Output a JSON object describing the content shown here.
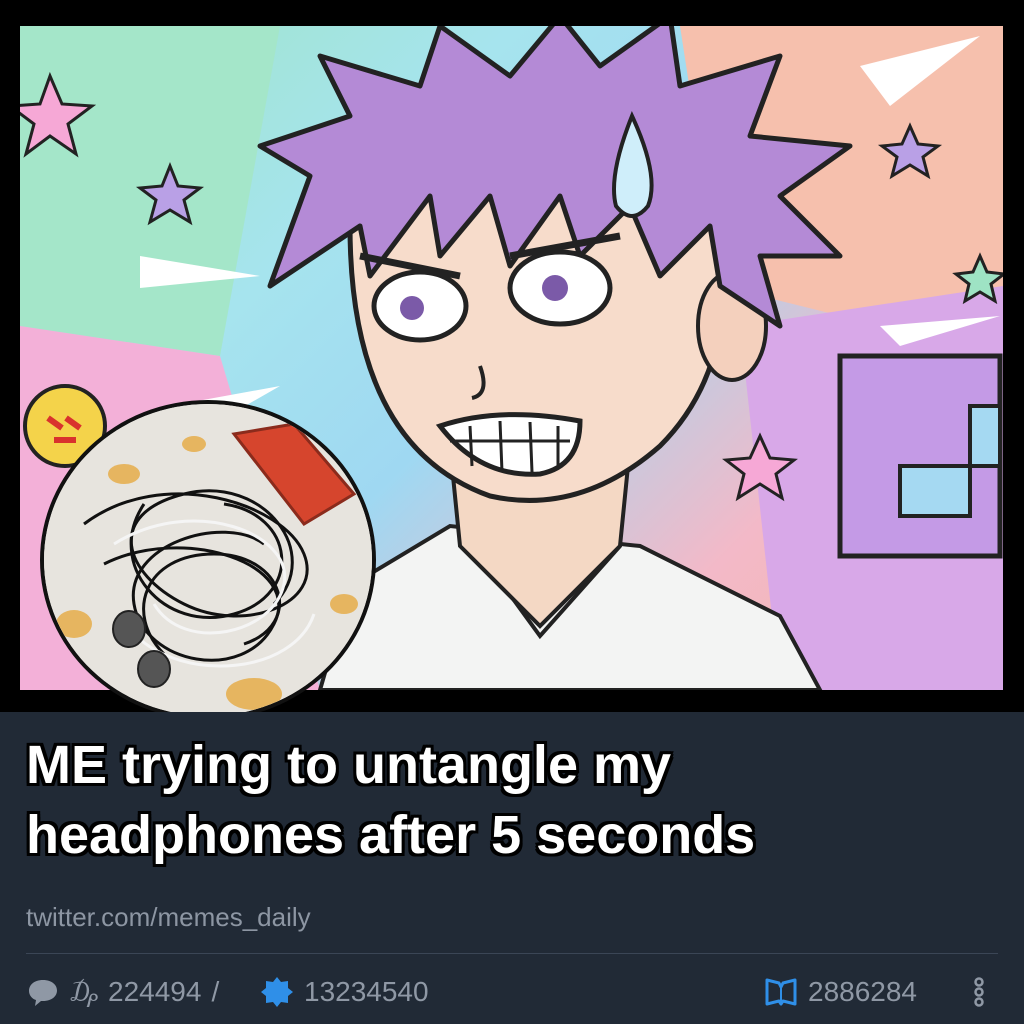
{
  "post": {
    "caption_line1": "ME trying to untangle my",
    "caption_line2": "headphones after 5 seconds",
    "source": "twitter.com/memes_daily"
  },
  "stats": {
    "comments_icon": "speech-bubble-icon",
    "currency_icon": "currency-sign-icon",
    "comments_count": "224494",
    "separator": "/",
    "share_icon": "badge-icon",
    "shares_count": "13234540",
    "likes_icon": "bookmark-icon",
    "likes_count": "2886284",
    "more_icon": "vertical-dots-icon"
  },
  "colors": {
    "caption_bg": "#212a36",
    "caption_text": "#ffffff",
    "meta_text": "#8f98a5",
    "share_icon": "#2f8fe8",
    "likes_icon": "#2f8fe8"
  }
}
